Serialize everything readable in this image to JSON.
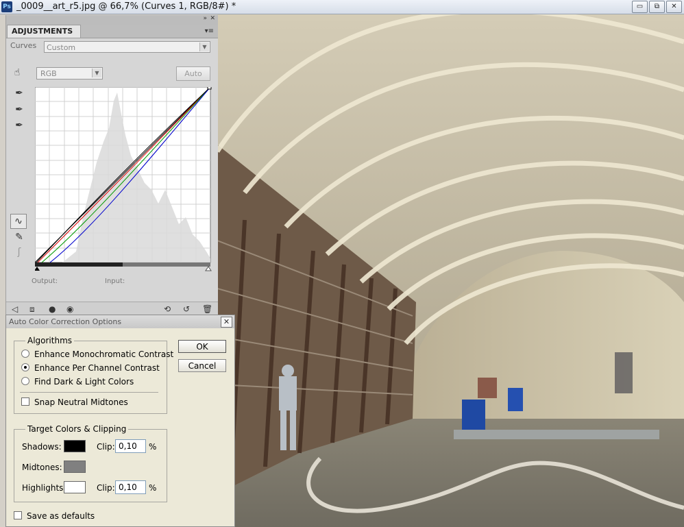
{
  "window": {
    "app_icon": "Ps",
    "title": "_0009__art_r5.jpg @ 66,7% (Curves 1, RGB/8#) *",
    "controls": {
      "minimize": "▭",
      "restore": "⧉",
      "close": "✕"
    }
  },
  "adjustments": {
    "tab_label": "ADJUSTMENTS",
    "curves_label": "Curves",
    "preset_value": "Custom",
    "channel_value": "RGB",
    "auto_label": "Auto",
    "output_label": "Output:",
    "input_label": "Input:"
  },
  "dialog": {
    "title": "Auto Color Correction Options",
    "algorithms_legend": "Algorithms",
    "options": [
      {
        "label": "Enhance Monochromatic Contrast",
        "selected": false
      },
      {
        "label": "Enhance Per Channel Contrast",
        "selected": true
      },
      {
        "label": "Find Dark & Light Colors",
        "selected": false
      }
    ],
    "snap_label": "Snap Neutral Midtones",
    "target_legend": "Target Colors & Clipping",
    "shadows_label": "Shadows:",
    "midtones_label": "Midtones:",
    "highlights_label": "Highlights:",
    "clip_label": "Clip:",
    "shadows_clip": "0,10",
    "highlights_clip": "0,10",
    "percent": "%",
    "save_defaults_label": "Save as defaults",
    "ok_label": "OK",
    "cancel_label": "Cancel",
    "colors": {
      "shadows": "#000000",
      "midtones": "#808080",
      "highlights": "#ffffff"
    }
  }
}
